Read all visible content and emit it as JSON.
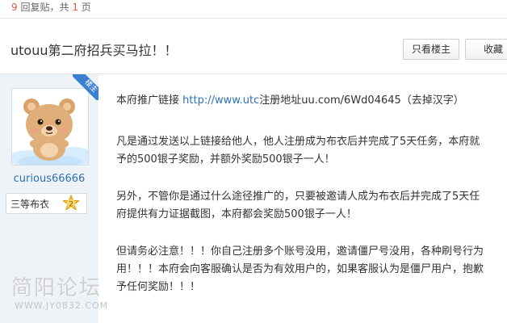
{
  "reply_summary": {
    "count": "9",
    "reply_label": "回复贴，共",
    "pages": "1",
    "page_label": "页"
  },
  "thread": {
    "title": "utouu第二府招兵买马拉！！"
  },
  "toolbar": {
    "only_op_label": "只看楼主",
    "collect_label": "收藏"
  },
  "author": {
    "ribbon_label": "楼主",
    "username": "curious66666",
    "rank_label": "三等布衣",
    "rank_level": "2"
  },
  "post": {
    "p1_prefix": "本府推广链接 ",
    "p1_link": "http://www.utc",
    "p1_rest": "注册地址uu.com/6Wd04645（去掉汉字）",
    "p2_line1": "凡是通过发送以上链接给他人，他人注册成为布衣后并完成了5天任务，本府就",
    "p2_line2": "予的500银子奖励，并额外奖励500银子一人！",
    "p3_line1": "另外，不管你是通过什么途径推广的，只要被邀请人成为布衣后并完成了5天任",
    "p3_line2": "府提供有力证据截图，本府都会奖励500银子一人！",
    "p4_line1": "但请务必注意！！！你自己注册多个账号没用，邀请僵尸号没用，各种刷号行为",
    "p4_line2": "用！！！本府会向客服确认是否为有效用户的，如果客服认为是僵尸用户，抱歉",
    "p4_line3": "予任何奖励！！！"
  },
  "watermark": {
    "title": "简阳论坛",
    "url": "WWW.JY0832.COM"
  },
  "colors": {
    "accent_number": "#e05c3b",
    "link": "#2e6fb2",
    "ribbon": "#3b7fd0",
    "sidebar_bg": "#eef3f8"
  }
}
